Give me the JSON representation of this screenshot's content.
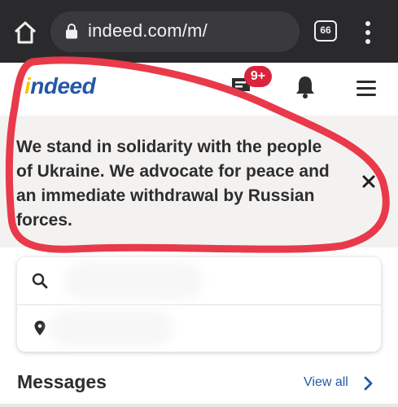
{
  "browser": {
    "url": "indeed.com/m/",
    "tab_count": "66",
    "icons": [
      "home-icon",
      "lock-icon",
      "menu-dots-icon"
    ]
  },
  "header": {
    "logo_text": "indeed",
    "message_badge": "9+",
    "icons": [
      "messages-icon",
      "bell-icon",
      "hamburger-icon"
    ]
  },
  "banner": {
    "text": "We stand in solidarity with the people of Ukraine. We advocate for peace and an immediate withdrawal by Russian forces.",
    "close_icon": "close-icon"
  },
  "search": {
    "what_icon": "search-icon",
    "where_icon": "location-pin-icon"
  },
  "messages": {
    "title": "Messages",
    "view_all_label": "View all"
  },
  "colors": {
    "indeed_blue": "#2557a7",
    "badge_red": "#d8243c",
    "annotation_red": "#e83a4a",
    "chrome_dark": "#2a2a2d"
  }
}
